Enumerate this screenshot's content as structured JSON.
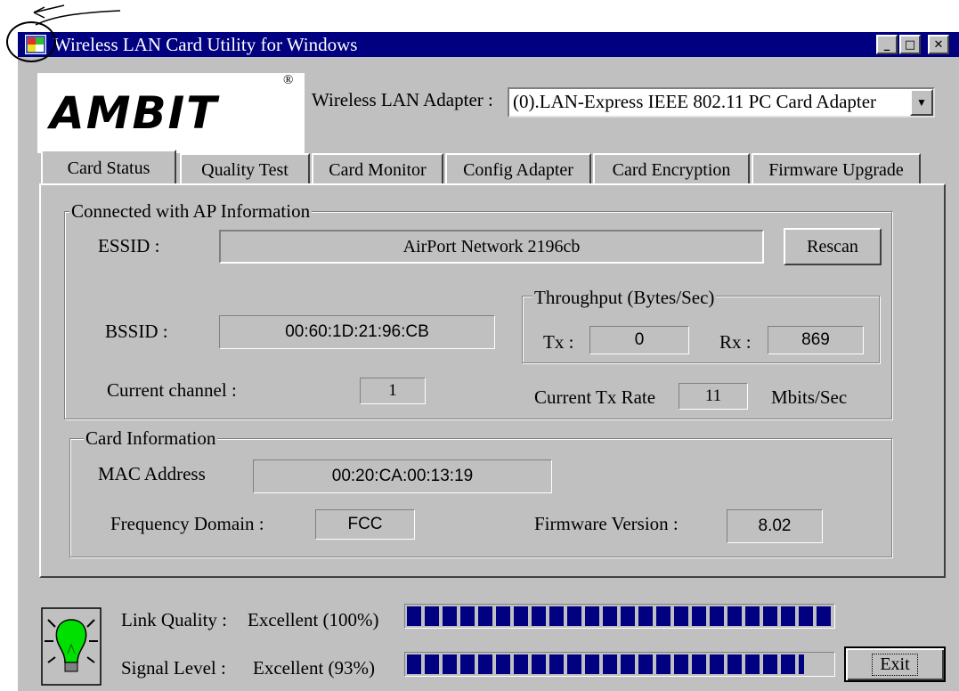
{
  "window": {
    "title": "Wireless LAN Card Utility for Windows",
    "controls": {
      "minimize": "_",
      "maximize": "□",
      "close": "✕"
    }
  },
  "logo": {
    "text": "AMBIT",
    "mark": "®"
  },
  "adapter": {
    "label": "Wireless LAN Adapter :",
    "value": "(0).LAN-Express IEEE 802.11 PC Card Adapter"
  },
  "tabs": [
    "Card Status",
    "Quality Test",
    "Card Monitor",
    "Config Adapter",
    "Card Encryption",
    "Firmware Upgrade"
  ],
  "ap_info": {
    "legend": "Connected with AP Information",
    "essid_label": "ESSID :",
    "essid_value": "AirPort Network 2196cb",
    "rescan_label": "Rescan",
    "bssid_label": "BSSID :",
    "bssid_value": "00:60:1D:21:96:CB",
    "channel_label": "Current channel :",
    "channel_value": "1",
    "throughput": {
      "legend": "Throughput (Bytes/Sec)",
      "tx_label": "Tx :",
      "tx_value": "0",
      "rx_label": "Rx :",
      "rx_value": "869"
    },
    "tx_rate_label": "Current Tx Rate",
    "tx_rate_value": "11",
    "tx_rate_unit": "Mbits/Sec"
  },
  "card_info": {
    "legend": "Card Information",
    "mac_label": "MAC Address",
    "mac_value": "00:20:CA:00:13:19",
    "freq_label": "Frequency Domain :",
    "freq_value": "FCC",
    "fw_label": "Firmware Version :",
    "fw_value": "8.02"
  },
  "status": {
    "link_label": "Link Quality :",
    "link_value": "Excellent (100%)",
    "link_fraction": 1.0,
    "signal_label": "Signal Level :",
    "signal_value": "Excellent (93%)",
    "signal_fraction": 0.93,
    "bar_color": "#000080",
    "bulb_color": "#00e000"
  },
  "exit_label": "Exit"
}
